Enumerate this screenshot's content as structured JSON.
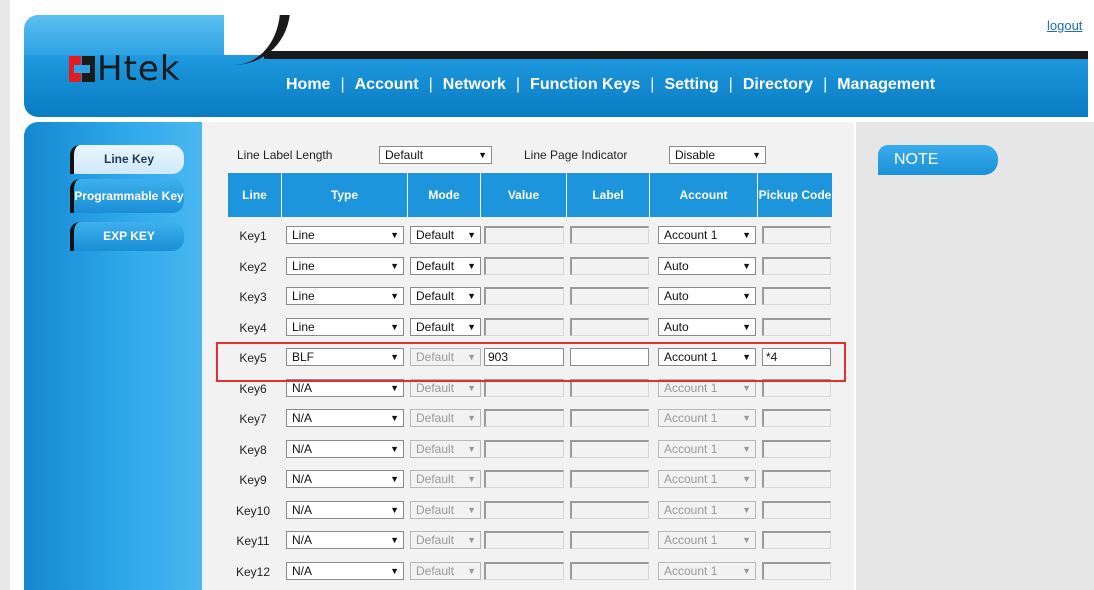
{
  "header": {
    "logo_text": "Htek",
    "logout": "logout",
    "nav": [
      "Home",
      "Account",
      "Network",
      "Function Keys",
      "Setting",
      "Directory",
      "Management"
    ],
    "active_nav": "Function Keys",
    "separator": "|"
  },
  "sidebar": {
    "items": [
      "Line Key",
      "Programmable Key",
      "EXP KEY"
    ],
    "active": "Line Key"
  },
  "controls": {
    "line_label_length_label": "Line Label Length",
    "line_label_length_value": "Default",
    "line_page_indicator_label": "Line Page Indicator",
    "line_page_indicator_value": "Disable"
  },
  "table": {
    "headers": [
      "Line",
      "Type",
      "Mode",
      "Value",
      "Label",
      "Account",
      "Pickup Code"
    ],
    "rows": [
      {
        "line": "Key1",
        "type": "Line",
        "mode": "Default",
        "value": "",
        "label": "",
        "account": "Account 1",
        "pickup": ""
      },
      {
        "line": "Key2",
        "type": "Line",
        "mode": "Default",
        "value": "",
        "label": "",
        "account": "Auto",
        "pickup": ""
      },
      {
        "line": "Key3",
        "type": "Line",
        "mode": "Default",
        "value": "",
        "label": "",
        "account": "Auto",
        "pickup": ""
      },
      {
        "line": "Key4",
        "type": "Line",
        "mode": "Default",
        "value": "",
        "label": "",
        "account": "Auto",
        "pickup": ""
      },
      {
        "line": "Key5",
        "type": "BLF",
        "mode": "Default",
        "value": "903",
        "label": "",
        "account": "Account 1",
        "pickup": "*4"
      },
      {
        "line": "Key6",
        "type": "N/A",
        "mode": "Default",
        "value": "",
        "label": "",
        "account": "Account 1",
        "pickup": ""
      },
      {
        "line": "Key7",
        "type": "N/A",
        "mode": "Default",
        "value": "",
        "label": "",
        "account": "Account 1",
        "pickup": ""
      },
      {
        "line": "Key8",
        "type": "N/A",
        "mode": "Default",
        "value": "",
        "label": "",
        "account": "Account 1",
        "pickup": ""
      },
      {
        "line": "Key9",
        "type": "N/A",
        "mode": "Default",
        "value": "",
        "label": "",
        "account": "Account 1",
        "pickup": ""
      },
      {
        "line": "Key10",
        "type": "N/A",
        "mode": "Default",
        "value": "",
        "label": "",
        "account": "Account 1",
        "pickup": ""
      },
      {
        "line": "Key11",
        "type": "N/A",
        "mode": "Default",
        "value": "",
        "label": "",
        "account": "Account 1",
        "pickup": ""
      },
      {
        "line": "Key12",
        "type": "N/A",
        "mode": "Default",
        "value": "",
        "label": "",
        "account": "Account 1",
        "pickup": ""
      }
    ],
    "highlighted_row": "Key5"
  },
  "note": {
    "title": "NOTE"
  },
  "colors": {
    "brand_blue": "#1d95dd",
    "highlight": "#e0302f",
    "logo_red": "#e31b23"
  }
}
